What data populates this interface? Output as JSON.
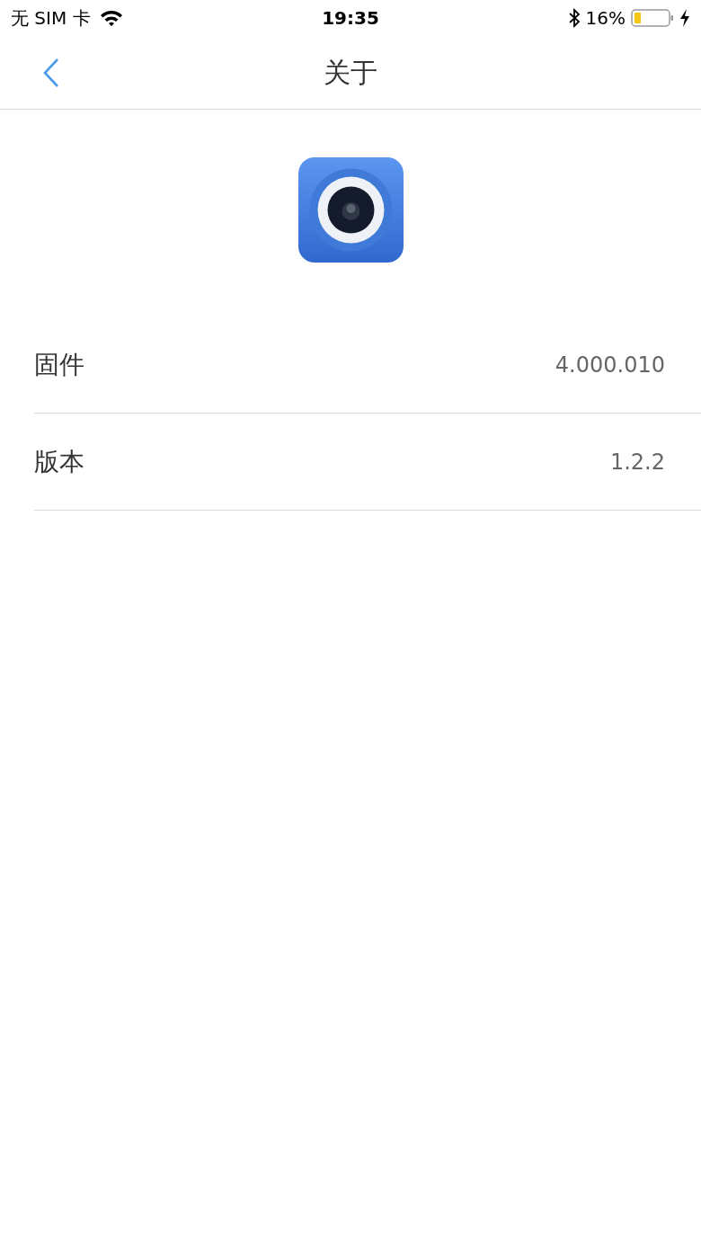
{
  "status_bar": {
    "carrier": "无 SIM 卡",
    "time": "19:35",
    "battery_percent": "16%"
  },
  "nav_bar": {
    "title": "关于"
  },
  "info_rows": [
    {
      "label": "固件",
      "value": "4.000.010"
    },
    {
      "label": "版本",
      "value": "1.2.2"
    }
  ]
}
